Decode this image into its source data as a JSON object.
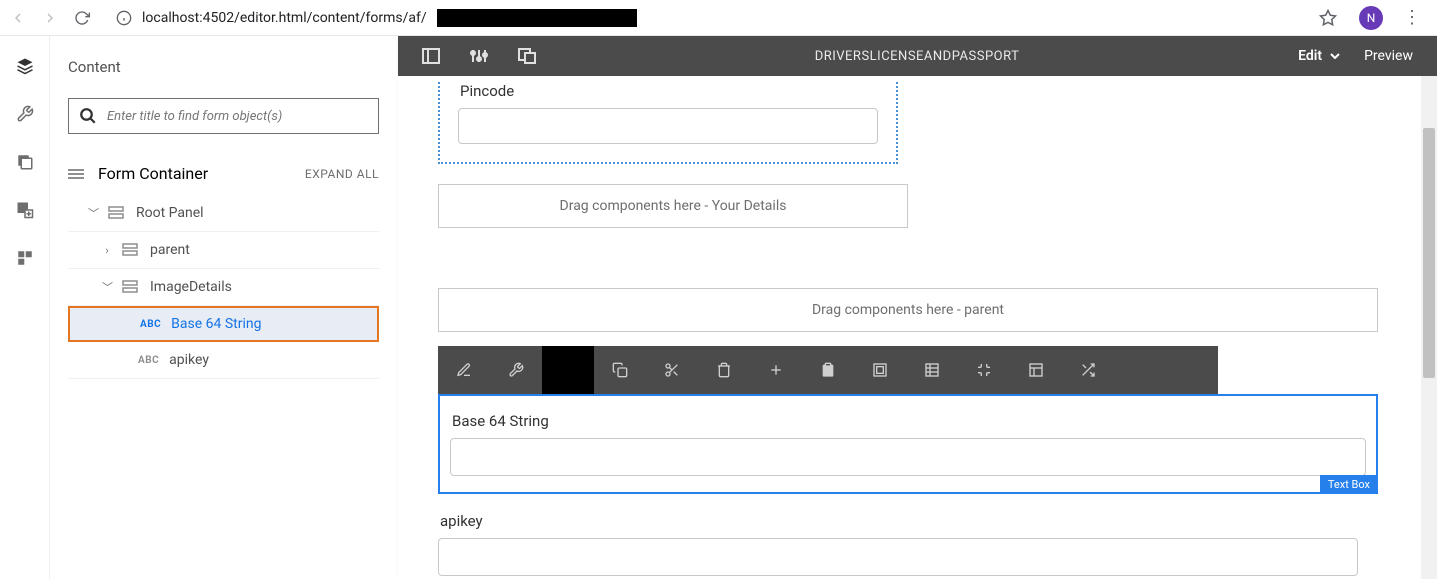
{
  "browser": {
    "url_prefix": "localhost:4502/editor.html/content/forms/af/",
    "avatar_initial": "N"
  },
  "sidebar": {
    "title": "Content",
    "search_placeholder": "Enter title to find form object(s)",
    "expand_all": "EXPAND ALL",
    "form_container": "Form Container",
    "root_panel": "Root Panel",
    "parent": "parent",
    "image_details": "ImageDetails",
    "base64": "Base 64 String",
    "apikey": "apikey",
    "abc_label": "ABC"
  },
  "topbar": {
    "title": "DRIVERSLICENSEANDPASSPORT",
    "edit": "Edit",
    "preview": "Preview"
  },
  "canvas": {
    "pincode_label": "Pincode",
    "drop_your_details": "Drag components here - Your Details",
    "drop_parent": "Drag components here - parent",
    "base64_label": "Base 64 String",
    "badge": "Text Box",
    "apikey_label": "apikey"
  }
}
